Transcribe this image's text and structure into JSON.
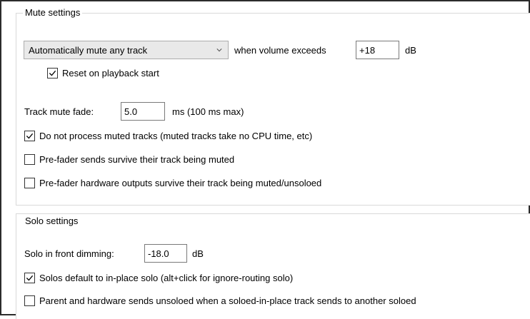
{
  "mute": {
    "title": "Mute settings",
    "mode_select": {
      "value": "Automatically mute any track"
    },
    "when_label": "when volume exceeds",
    "threshold_value": "+18",
    "threshold_unit": "dB",
    "reset_on_playback": {
      "label": "Reset on playback start",
      "checked": true
    },
    "fade_label": "Track mute fade:",
    "fade_value": "5.0",
    "fade_unit": "ms (100 ms max)",
    "options": [
      {
        "label": "Do not process muted tracks (muted tracks take no CPU time, etc)",
        "checked": true
      },
      {
        "label": "Pre-fader sends survive their track being muted",
        "checked": false
      },
      {
        "label": "Pre-fader hardware outputs survive their track being muted/unsoloed",
        "checked": false
      }
    ]
  },
  "solo": {
    "title": "Solo settings",
    "dimming_label": "Solo in front dimming:",
    "dimming_value": "-18.0",
    "dimming_unit": "dB",
    "options": [
      {
        "label": "Solos default to in-place solo (alt+click for ignore-routing solo)",
        "checked": true
      },
      {
        "label": "Parent and hardware sends unsoloed when a soloed-in-place track sends to another soloed",
        "checked": false
      }
    ]
  }
}
